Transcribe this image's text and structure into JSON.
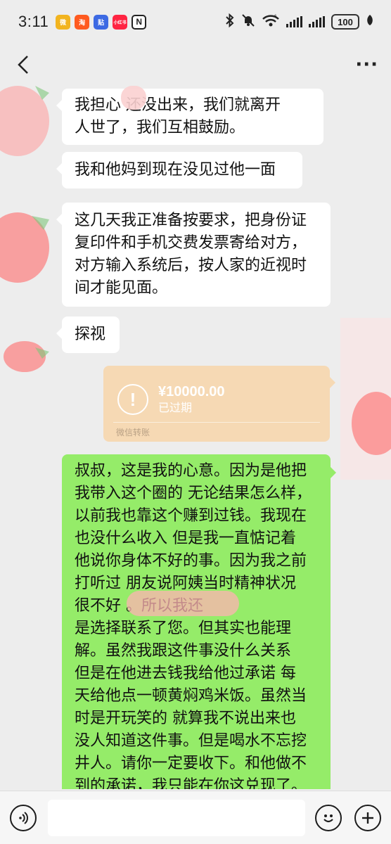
{
  "status_bar": {
    "time": "3:11",
    "app_icons": [
      {
        "name": "weibo-icon",
        "color": "#f2b41f",
        "glyph": "微"
      },
      {
        "name": "taobao-icon",
        "color": "#ff5a1f",
        "glyph": "淘"
      },
      {
        "name": "tieba-icon",
        "color": "#3d6ae3",
        "glyph": "贴"
      },
      {
        "name": "xiaohongshu-icon",
        "color": "#ff2442",
        "glyph": "小红书"
      },
      {
        "name": "nfc-icon",
        "color": "#222222",
        "glyph": "N"
      }
    ],
    "battery": "100",
    "network": "5G"
  },
  "nav": {
    "back_icon": "chevron-left-icon",
    "more_icon": "more-dots-icon"
  },
  "messages": [
    {
      "side": "left",
      "text_lines": [
        "我担心    还没出来，我们就离开",
        "人世了，我们互相鼓励。"
      ]
    },
    {
      "side": "left",
      "text_lines": [
        "我和他妈到现在没见过他一面"
      ]
    },
    {
      "side": "left",
      "text_lines": [
        "这几天我正准备按要求，把身份证",
        "复印件和手机交费发票寄给对方，",
        "对方输入系统后，按人家的近视时",
        "间才能见面。"
      ]
    },
    {
      "side": "left",
      "text_lines": [
        "探视"
      ]
    }
  ],
  "transfer": {
    "amount": "¥10000.00",
    "status": "已过期",
    "footer": "微信转账",
    "icon": "exclamation-icon",
    "color": "#f6d9b4"
  },
  "my_message": {
    "text_lines": [
      "叔叔，这是我的心意。因为是他把",
      "我带入这个圈的 无论结果怎么样，",
      "以前我也靠这个赚到过钱。我现在",
      "也没什么收入 但是我一直惦记着",
      "他说你身体不好的事。因为我之前",
      "打听过 朋友说阿姨当时精神状况",
      "很不好             。所以我还",
      "是选择联系了您。但其实也能理",
      "解。虽然我跟这件事没什么关系",
      "但是在他进去钱我给他过承诺 每",
      "天给他点一顿黄焖鸡米饭。虽然当",
      "时是开玩笑的 就算我不说出来也",
      "没人知道这件事。但是喝水不忘挖",
      "井人。请你一定要收下。和他做不",
      "到的承诺，我只能在你这兑现了。"
    ],
    "color": "#95ec69"
  },
  "input_bar": {
    "voice_icon": "voice-icon",
    "emoji_icon": "emoji-icon",
    "plus_icon": "plus-icon",
    "placeholder": ""
  }
}
